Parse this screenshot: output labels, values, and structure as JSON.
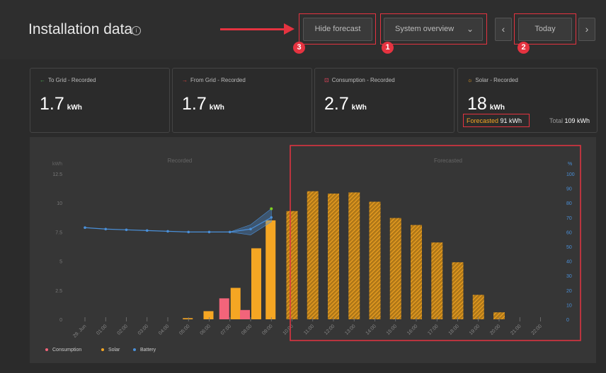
{
  "header": {
    "title": "Installation data",
    "hide_forecast_label": "Hide forecast",
    "system_select_value": "System overview",
    "today_label": "Today",
    "badges": [
      "1",
      "2",
      "3"
    ]
  },
  "cards": [
    {
      "label": "To Grid - Recorded",
      "icon": "arrow-left-icon",
      "icon_char": "←",
      "icon_color": "#4cb050",
      "value": "1.7",
      "unit": "kWh"
    },
    {
      "label": "From Grid - Recorded",
      "icon": "arrow-right-icon",
      "icon_char": "→",
      "icon_color": "#e5453f",
      "value": "1.7",
      "unit": "kWh"
    },
    {
      "label": "Consumption - Recorded",
      "icon": "plug-icon",
      "icon_char": "⊡",
      "icon_color": "#f0475f",
      "value": "2.7",
      "unit": "kWh"
    },
    {
      "label": "Solar - Recorded",
      "icon": "sun-icon",
      "icon_char": "☼",
      "icon_color": "#f5a623",
      "value": "18",
      "unit": "kWh"
    }
  ],
  "solar_extra": {
    "forecasted_label": "Forecasted",
    "forecasted_value": "91 kWh",
    "total_label": "Total",
    "total_value": "109 kWh"
  },
  "chart_data": {
    "type": "bar",
    "section_labels": [
      "Recorded",
      "Forecasted"
    ],
    "ylabel": "kWh",
    "y2label": "%",
    "ylim": [
      0,
      12.5
    ],
    "y2lim": [
      0,
      100
    ],
    "yticks": [
      "0",
      "2.5",
      "5",
      "7.5",
      "10",
      "12.5"
    ],
    "y2ticks": [
      "0",
      "10",
      "20",
      "30",
      "40",
      "50",
      "60",
      "70",
      "80",
      "90",
      "100"
    ],
    "categories": [
      "29. Jun",
      "01:00",
      "02:00",
      "03:00",
      "04:00",
      "05:00",
      "06:00",
      "07:00",
      "08:00",
      "09:00",
      "10:00",
      "11:00",
      "12:00",
      "13:00",
      "14:00",
      "15:00",
      "16:00",
      "17:00",
      "18:00",
      "19:00",
      "20:00",
      "21:00",
      "22:00"
    ],
    "series": [
      {
        "name": "Consumption",
        "color": "#f2647a",
        "values": [
          0,
          0,
          0,
          0,
          0,
          0,
          0,
          1.8,
          0.8,
          0,
          0,
          0,
          0,
          0,
          0,
          0,
          0,
          0,
          0,
          0,
          0,
          0,
          0
        ]
      },
      {
        "name": "Solar",
        "color": "#f5a623",
        "values": [
          0,
          0,
          0,
          0,
          0,
          0.1,
          0.7,
          2.7,
          6.1,
          8.5,
          9.3,
          11.0,
          10.8,
          10.9,
          10.1,
          8.7,
          8.1,
          6.6,
          4.9,
          2.1,
          0.6,
          0,
          0
        ],
        "forecast_from": "10:00"
      },
      {
        "name": "Battery",
        "color": "#4a90d9",
        "axis": "right",
        "values": [
          63,
          62,
          61.5,
          61,
          60.5,
          60,
          60,
          60,
          62,
          70
        ]
      }
    ],
    "legend_position": "bottom-left"
  }
}
